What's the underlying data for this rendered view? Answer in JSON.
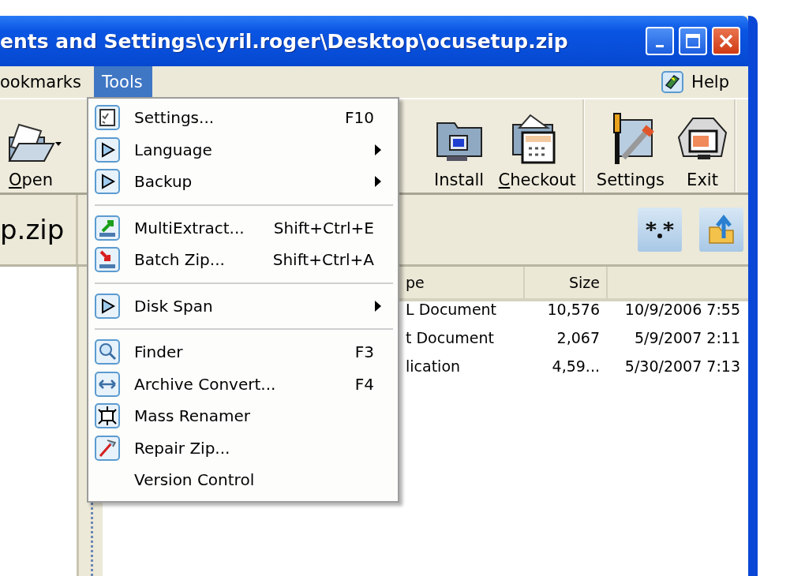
{
  "window": {
    "title": "ents and Settings\\cyril.roger\\Desktop\\ocusetup.zip"
  },
  "menu_bar": {
    "items": [
      {
        "label": "ookmarks",
        "selected": false
      },
      {
        "label": "Tools",
        "selected": true
      }
    ],
    "help": "Help"
  },
  "toolbar": {
    "left": [
      {
        "label": "Open",
        "mnemonic": true,
        "dropdown": true
      }
    ],
    "right": [
      {
        "label": "Install",
        "mnemonic": false,
        "separator_after": false
      },
      {
        "label": "Checkout",
        "mnemonic": true,
        "separator_after": true
      },
      {
        "label": "Settings",
        "mnemonic": false,
        "separator_after": false
      },
      {
        "label": "Exit",
        "mnemonic": false,
        "separator_after": true
      }
    ]
  },
  "archive_tab": {
    "label": "p.zip"
  },
  "file_list": {
    "columns": [
      "pe",
      "Size"
    ],
    "rows": [
      {
        "column_1": "L Document",
        "size": "10,576",
        "column_3": "10/9/2006 7:55"
      },
      {
        "column_1": "t Document",
        "size": "2,067",
        "column_3": "5/9/2007 2:11"
      },
      {
        "column_1": "lication",
        "size": "4,59...",
        "column_3": "5/30/2007 7:13"
      }
    ]
  },
  "tools_menu": {
    "groups": [
      [
        {
          "label": "Settings...",
          "shortcut": "F10",
          "submenu": false
        },
        {
          "label": "Language",
          "submenu": true
        },
        {
          "label": "Backup",
          "submenu": true
        }
      ],
      [
        {
          "label": "MultiExtract...",
          "shortcut": "Shift+Ctrl+E",
          "submenu": false
        },
        {
          "label": "Batch Zip...",
          "shortcut": "Shift+Ctrl+A",
          "submenu": false
        }
      ],
      [
        {
          "label": "Disk Span",
          "submenu": true
        }
      ],
      [
        {
          "label": "Finder",
          "shortcut": "F3",
          "submenu": false
        },
        {
          "label": "Archive Convert...",
          "shortcut": "F4",
          "submenu": false
        },
        {
          "label": "Mass Renamer",
          "submenu": false
        },
        {
          "label": "Repair Zip...",
          "submenu": false
        },
        {
          "label": "Version Control",
          "submenu": false
        }
      ]
    ]
  }
}
